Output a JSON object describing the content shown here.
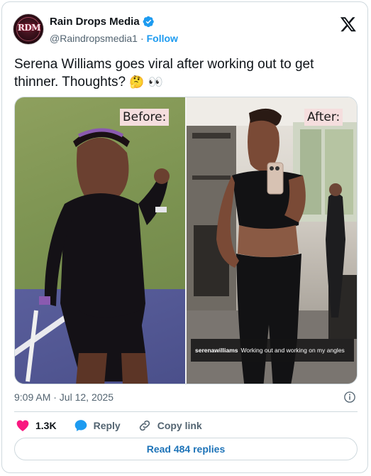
{
  "header": {
    "avatar_text": "RDM",
    "display_name": "Rain Drops Media",
    "handle": "@Raindropsmedia1",
    "separator": "·",
    "follow_label": "Follow"
  },
  "tweet": {
    "text": "Serena Williams goes viral after working out to get thinner. Thoughts?",
    "emoji": "🤔 👀"
  },
  "media": {
    "left_label": "Before:",
    "right_label": "After:",
    "caption_user": "serenawilliams",
    "caption_text": "Working out and working on my angles"
  },
  "footer": {
    "timestamp": "9:09 AM · Jul 12, 2025",
    "like_count": "1.3K",
    "reply_label": "Reply",
    "copy_link_label": "Copy link",
    "read_replies_label": "Read 484 replies"
  },
  "colors": {
    "accent": "#1d9bf0",
    "heart": "#f91880",
    "text": "#0f1419",
    "muted": "#536471"
  },
  "icons": {
    "verified": "verified-badge-icon",
    "brand": "x-logo-icon",
    "info": "info-icon",
    "like": "heart-icon",
    "reply": "speech-bubble-icon",
    "copy": "link-icon"
  }
}
